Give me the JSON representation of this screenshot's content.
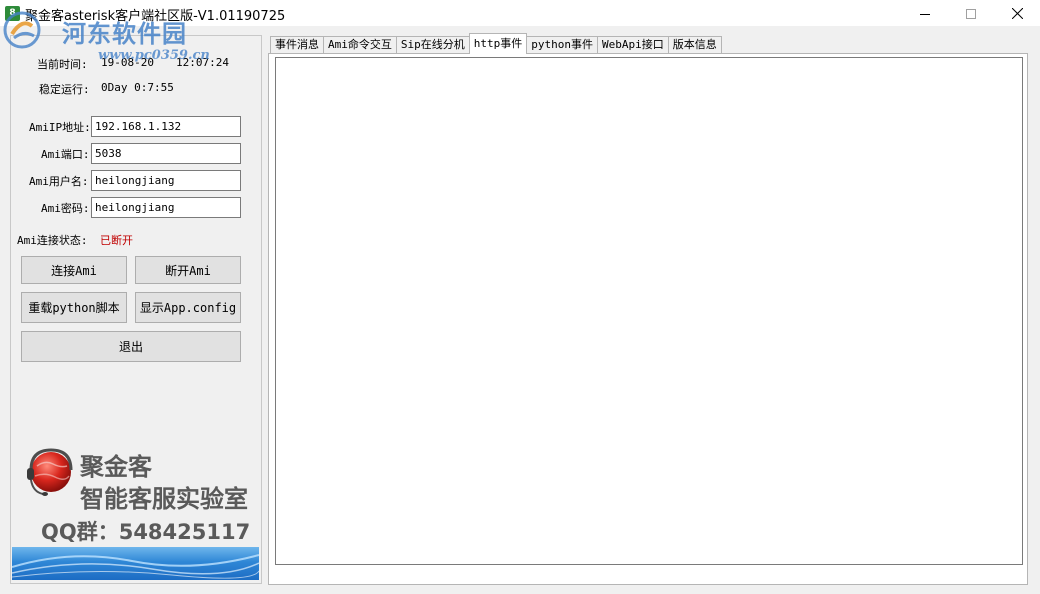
{
  "window": {
    "title": "聚金客asterisk客户端社区版-V1.01190725",
    "app_icon_text": "8"
  },
  "watermark": {
    "site_name": "河东软件园",
    "url": "www.pc0359.cn"
  },
  "left_panel": {
    "current_time_label": "当前时间:",
    "current_date": "19-08-20",
    "current_time": "12:07:24",
    "uptime_label": "稳定运行:",
    "uptime_value": "0Day 0:7:55",
    "fields": {
      "ami_ip": {
        "label": "AmiIP地址:",
        "value": "192.168.1.132"
      },
      "ami_port": {
        "label": "Ami端口:",
        "value": "5038"
      },
      "ami_user": {
        "label": "Ami用户名:",
        "value": "heilongjiang"
      },
      "ami_password": {
        "label": "Ami密码:",
        "value": "heilongjiang"
      }
    },
    "status_label": "Ami连接状态:",
    "status_value": "已断开",
    "status_color": "#c00000",
    "buttons": {
      "connect": "连接Ami",
      "disconnect": "断开Ami",
      "reload_python": "重载python脚本",
      "show_config": "显示App.config",
      "exit": "退出"
    }
  },
  "branding": {
    "line1": "聚金客",
    "line2": "智能客服实验室",
    "qq": "QQ群：548425117"
  },
  "tabs": [
    {
      "label": "事件消息",
      "active": false
    },
    {
      "label": "Ami命令交互",
      "active": false
    },
    {
      "label": "Sip在线分机",
      "active": false
    },
    {
      "label": "http事件",
      "active": true
    },
    {
      "label": "python事件",
      "active": false
    },
    {
      "label": "WebApi接口",
      "active": false
    },
    {
      "label": "版本信息",
      "active": false
    }
  ]
}
